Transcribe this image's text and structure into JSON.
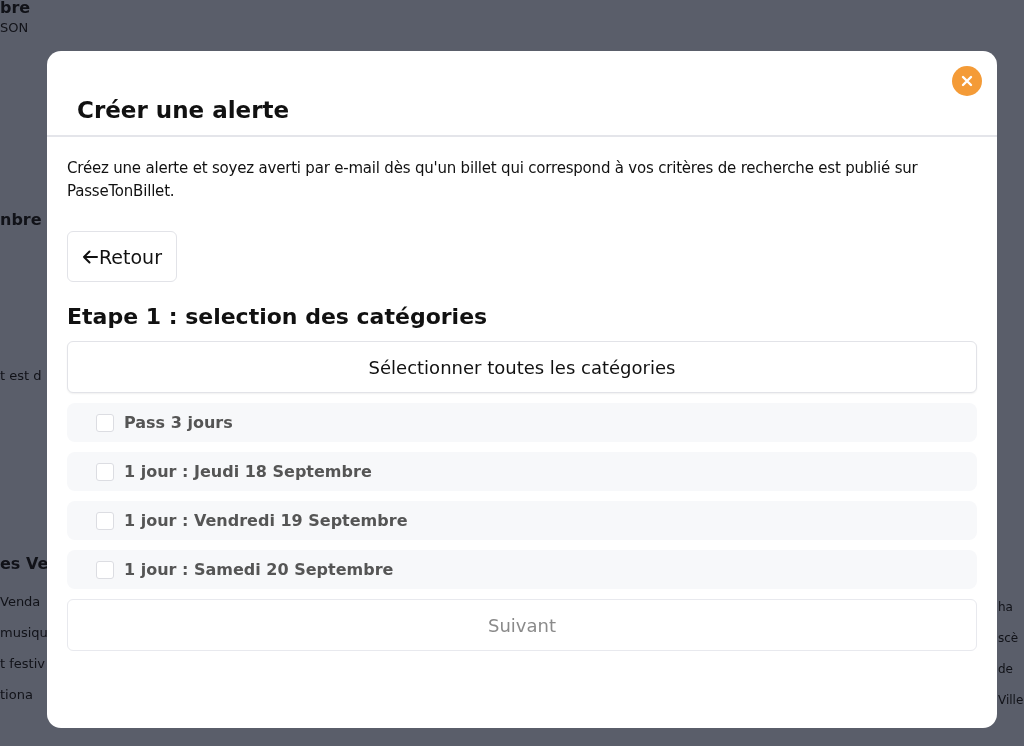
{
  "background_page": {
    "left_fragments": [
      {
        "text": "bre",
        "kind": "heading"
      },
      {
        "text": "SON",
        "kind": "text"
      },
      {
        "text": "nbre",
        "kind": "heading"
      },
      {
        "text": "t est d",
        "kind": "text"
      },
      {
        "text": "es Ve",
        "kind": "heading"
      },
      {
        "text": "Venda",
        "kind": "text"
      },
      {
        "text": "musiqu",
        "kind": "text"
      },
      {
        "text": "t festiv",
        "kind": "text"
      },
      {
        "text": "tiona",
        "kind": "text"
      }
    ],
    "right_fragments": [
      "ha",
      "scè",
      "de",
      "Ville"
    ]
  },
  "dialog": {
    "title": "Créer une alerte",
    "description": "Créez une alerte et soyez averti par e-mail dès qu'un billet qui correspond à vos critères de recherche est publié sur PasseTonBillet.",
    "back_button": "Retour",
    "step_title": "Etape 1 : selection des catégories",
    "select_all_button": "Sélectionner toutes les catégories",
    "categories": [
      {
        "label": "Pass 3 jours",
        "checked": false
      },
      {
        "label": "1 jour : Jeudi 18 Septembre",
        "checked": false
      },
      {
        "label": "1 jour : Vendredi 19 Septembre",
        "checked": false
      },
      {
        "label": "1 jour : Samedi 20 Septembre",
        "checked": false
      }
    ],
    "next_button": {
      "label": "Suivant",
      "disabled": true
    }
  }
}
